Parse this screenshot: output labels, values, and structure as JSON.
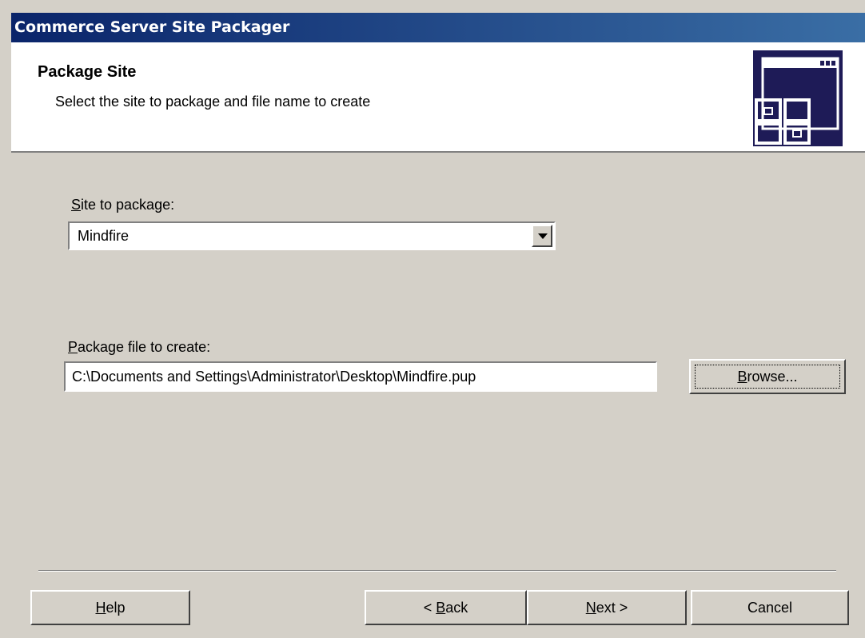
{
  "window": {
    "title": "Commerce Server Site Packager"
  },
  "header": {
    "title": "Package Site",
    "subtitle": "Select the site to package and file name to create",
    "icon": "wizard-window-icon"
  },
  "site": {
    "label_accel": "S",
    "label_rest": "ite to package:",
    "selected": "Mindfire"
  },
  "package_file": {
    "label_accel": "P",
    "label_rest": "ackage file to create:",
    "value": "C:\\Documents and Settings\\Administrator\\Desktop\\Mindfire.pup",
    "browse_accel": "B",
    "browse_rest": "rowse..."
  },
  "buttons": {
    "help_accel": "H",
    "help_rest": "elp",
    "back_pre": "< ",
    "back_accel": "B",
    "back_rest": "ack",
    "next_accel": "N",
    "next_rest": "ext >",
    "cancel": "Cancel"
  }
}
